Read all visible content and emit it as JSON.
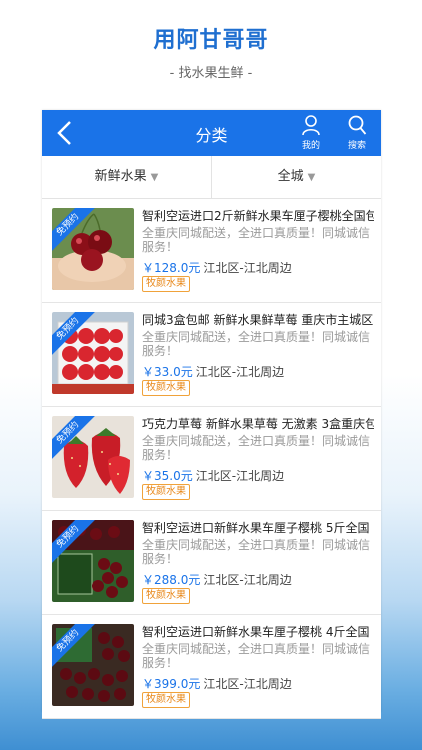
{
  "app": {
    "title": "用阿甘哥哥",
    "subtitle": "- 找水果生鲜 -"
  },
  "nav": {
    "title": "分类",
    "profile_label": "我的",
    "search_label": "搜索"
  },
  "filters": {
    "category": "新鲜水果",
    "region": "全城"
  },
  "ribbon_label": "免预约",
  "items": [
    {
      "title": "智利空运进口2斤新鲜水果车厘子樱桃全国包",
      "desc": "全重庆同城配送，全进口真质量！同城诚信服务！",
      "price": "￥128.0元",
      "location": "江北区-江北周边",
      "tag": "牧颜水果"
    },
    {
      "title": "同城3盒包邮 新鲜水果鲜草莓 重庆市主城区",
      "desc": "全重庆同城配送，全进口真质量！同城诚信服务！",
      "price": "￥33.0元",
      "location": "江北区-江北周边",
      "tag": "牧颜水果"
    },
    {
      "title": "巧克力草莓 新鲜水果草莓 无激素 3盒重庆包",
      "desc": "全重庆同城配送，全进口真质量！同城诚信服务！",
      "price": "￥35.0元",
      "location": "江北区-江北周边",
      "tag": "牧颜水果"
    },
    {
      "title": "智利空运进口新鲜水果车厘子樱桃 5斤全国",
      "desc": "全重庆同城配送，全进口真质量！同城诚信服务！",
      "price": "￥288.0元",
      "location": "江北区-江北周边",
      "tag": "牧颜水果"
    },
    {
      "title": "智利空运进口新鲜水果车厘子樱桃 4斤全国",
      "desc": "全重庆同城配送，全进口真质量！同城诚信服务！",
      "price": "￥399.0元",
      "location": "江北区-江北周边",
      "tag": "牧颜水果"
    }
  ]
}
